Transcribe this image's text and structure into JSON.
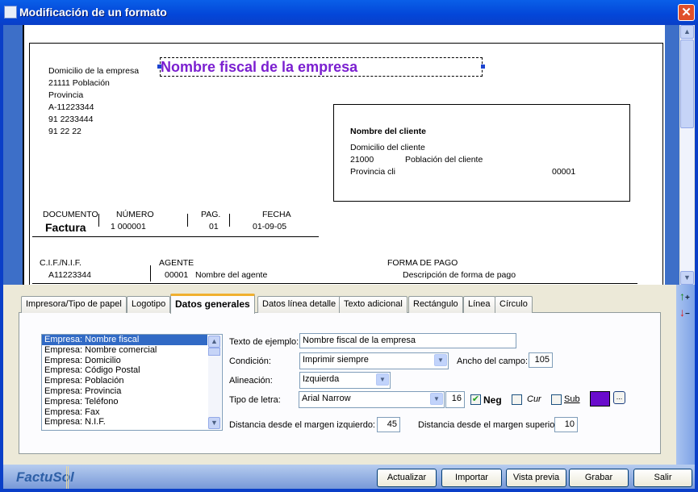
{
  "window": {
    "title": "Modificación de un formato",
    "close": "✕"
  },
  "preview": {
    "company_title": "Nombre fiscal de la empresa",
    "company_lines": [
      "Domicilio de la empresa",
      "21111  Población",
      "Provincia",
      "A-11223344",
      "91 2233444",
      "91 22 22"
    ],
    "client": {
      "name": "Nombre del cliente",
      "address": "Domicilio del cliente",
      "cp": "21000",
      "city": "Población del cliente",
      "province": "Provincia cli",
      "code": "00001"
    },
    "header": {
      "documento_label": "DOCUMENTO",
      "documento": "Factura",
      "numero_label": "NÚMERO",
      "numero": "1 000001",
      "pag_label": "PAG.",
      "pag": "01",
      "fecha_label": "FECHA",
      "fecha": "01-09-05"
    },
    "row2": {
      "cif_label": "C.I.F./N.I.F.",
      "cif": "A11223344",
      "agente_label": "AGENTE",
      "agente_code": "00001",
      "agente": "Nombre del agente",
      "pago_label": "FORMA DE PAGO",
      "pago": "Descripción de forma de pago"
    },
    "title_color": "#7b1fd0"
  },
  "tabs": [
    {
      "label": "Impresora/Tipo de papel"
    },
    {
      "label": "Logotipo"
    },
    {
      "label": "Datos generales",
      "active": true
    },
    {
      "label": "Datos línea detalle"
    },
    {
      "label": "Texto adicional"
    },
    {
      "label": "Rectángulo"
    },
    {
      "label": "Línea"
    },
    {
      "label": "Círculo"
    }
  ],
  "fields_list": [
    "Empresa: Nombre fiscal",
    "Empresa: Nombre comercial",
    "Empresa: Domicilio",
    "Empresa: Código Postal",
    "Empresa: Población",
    "Empresa: Provincia",
    "Empresa: Teléfono",
    "Empresa: Fax",
    "Empresa: N.I.F."
  ],
  "form": {
    "texto_label": "Texto de ejemplo:",
    "texto": "Nombre fiscal de la empresa",
    "condicion_label": "Condición:",
    "condicion": "Imprimir siempre",
    "ancho_label": "Ancho del campo:",
    "ancho": "105",
    "alineacion_label": "Alineación:",
    "alineacion": "Izquierda",
    "tipo_label": "Tipo de letra:",
    "tipo": "Arial Narrow",
    "size": "16",
    "neg_label": "Neg",
    "neg_checked": true,
    "cur_label": "Cur",
    "cur_checked": false,
    "sub_label": "Sub",
    "sub_checked": false,
    "color": "#6a0ccc",
    "color_btn": "...",
    "izq_label": "Distancia desde el margen izquierdo:",
    "izq": "45",
    "sup_label": "Distancia desde el margen superior:",
    "sup": "10"
  },
  "footer": {
    "logo": "FactuSol",
    "buttons": [
      "Actualizar",
      "Importar",
      "Vista previa",
      "Grabar",
      "Salir"
    ]
  }
}
